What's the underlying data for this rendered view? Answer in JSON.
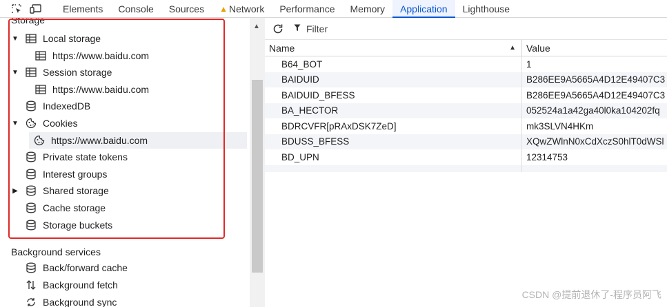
{
  "tabs": [
    {
      "label": "Elements"
    },
    {
      "label": "Console"
    },
    {
      "label": "Sources"
    },
    {
      "label": "Network"
    },
    {
      "label": "Performance"
    },
    {
      "label": "Memory"
    },
    {
      "label": "Application"
    },
    {
      "label": "Lighthouse"
    }
  ],
  "active_tab": "Application",
  "sidebar": {
    "storage_title": "Storage",
    "items": [
      {
        "label": "Local storage",
        "icon": "table-icon",
        "expanded": true
      },
      {
        "label": "https://www.baidu.com",
        "icon": "table-icon"
      },
      {
        "label": "Session storage",
        "icon": "table-icon",
        "expanded": true
      },
      {
        "label": "https://www.baidu.com",
        "icon": "table-icon"
      },
      {
        "label": "IndexedDB",
        "icon": "database-icon"
      },
      {
        "label": "Cookies",
        "icon": "cookie-icon",
        "expanded": true
      },
      {
        "label": "https://www.baidu.com",
        "icon": "cookie-icon",
        "selected": true
      },
      {
        "label": "Private state tokens",
        "icon": "database-icon"
      },
      {
        "label": "Interest groups",
        "icon": "database-icon"
      },
      {
        "label": "Shared storage",
        "icon": "database-icon",
        "expanded": false
      },
      {
        "label": "Cache storage",
        "icon": "database-icon"
      },
      {
        "label": "Storage buckets",
        "icon": "database-icon"
      }
    ],
    "background_title": "Background services",
    "background_items": [
      {
        "label": "Back/forward cache",
        "icon": "database-icon"
      },
      {
        "label": "Background fetch",
        "icon": "sync-arrows-icon"
      },
      {
        "label": "Background sync",
        "icon": "sync-circle-icon"
      }
    ]
  },
  "toolbar": {
    "filter_placeholder": "Filter"
  },
  "table": {
    "columns": {
      "name": "Name",
      "value": "Value"
    },
    "rows": [
      {
        "name": "B64_BOT",
        "value": "1"
      },
      {
        "name": "BAIDUID",
        "value": "B286EE9A5665A4D12E49407C3"
      },
      {
        "name": "BAIDUID_BFESS",
        "value": "B286EE9A5665A4D12E49407C3"
      },
      {
        "name": "BA_HECTOR",
        "value": "052524a1a42ga40l0ka104202fq"
      },
      {
        "name": "BDRCVFR[pRAxDSK7ZeD]",
        "value": "mk3SLVN4HKm"
      },
      {
        "name": "BDUSS_BFESS",
        "value": "XQwZWlnN0xCdXczS0hlT0dWSl"
      },
      {
        "name": "BD_UPN",
        "value": "12314753"
      }
    ]
  },
  "watermark": "CSDN @提前退休了-程序员阿飞",
  "colors": {
    "accent": "#0b57d0",
    "highlight_box": "#e02727"
  }
}
